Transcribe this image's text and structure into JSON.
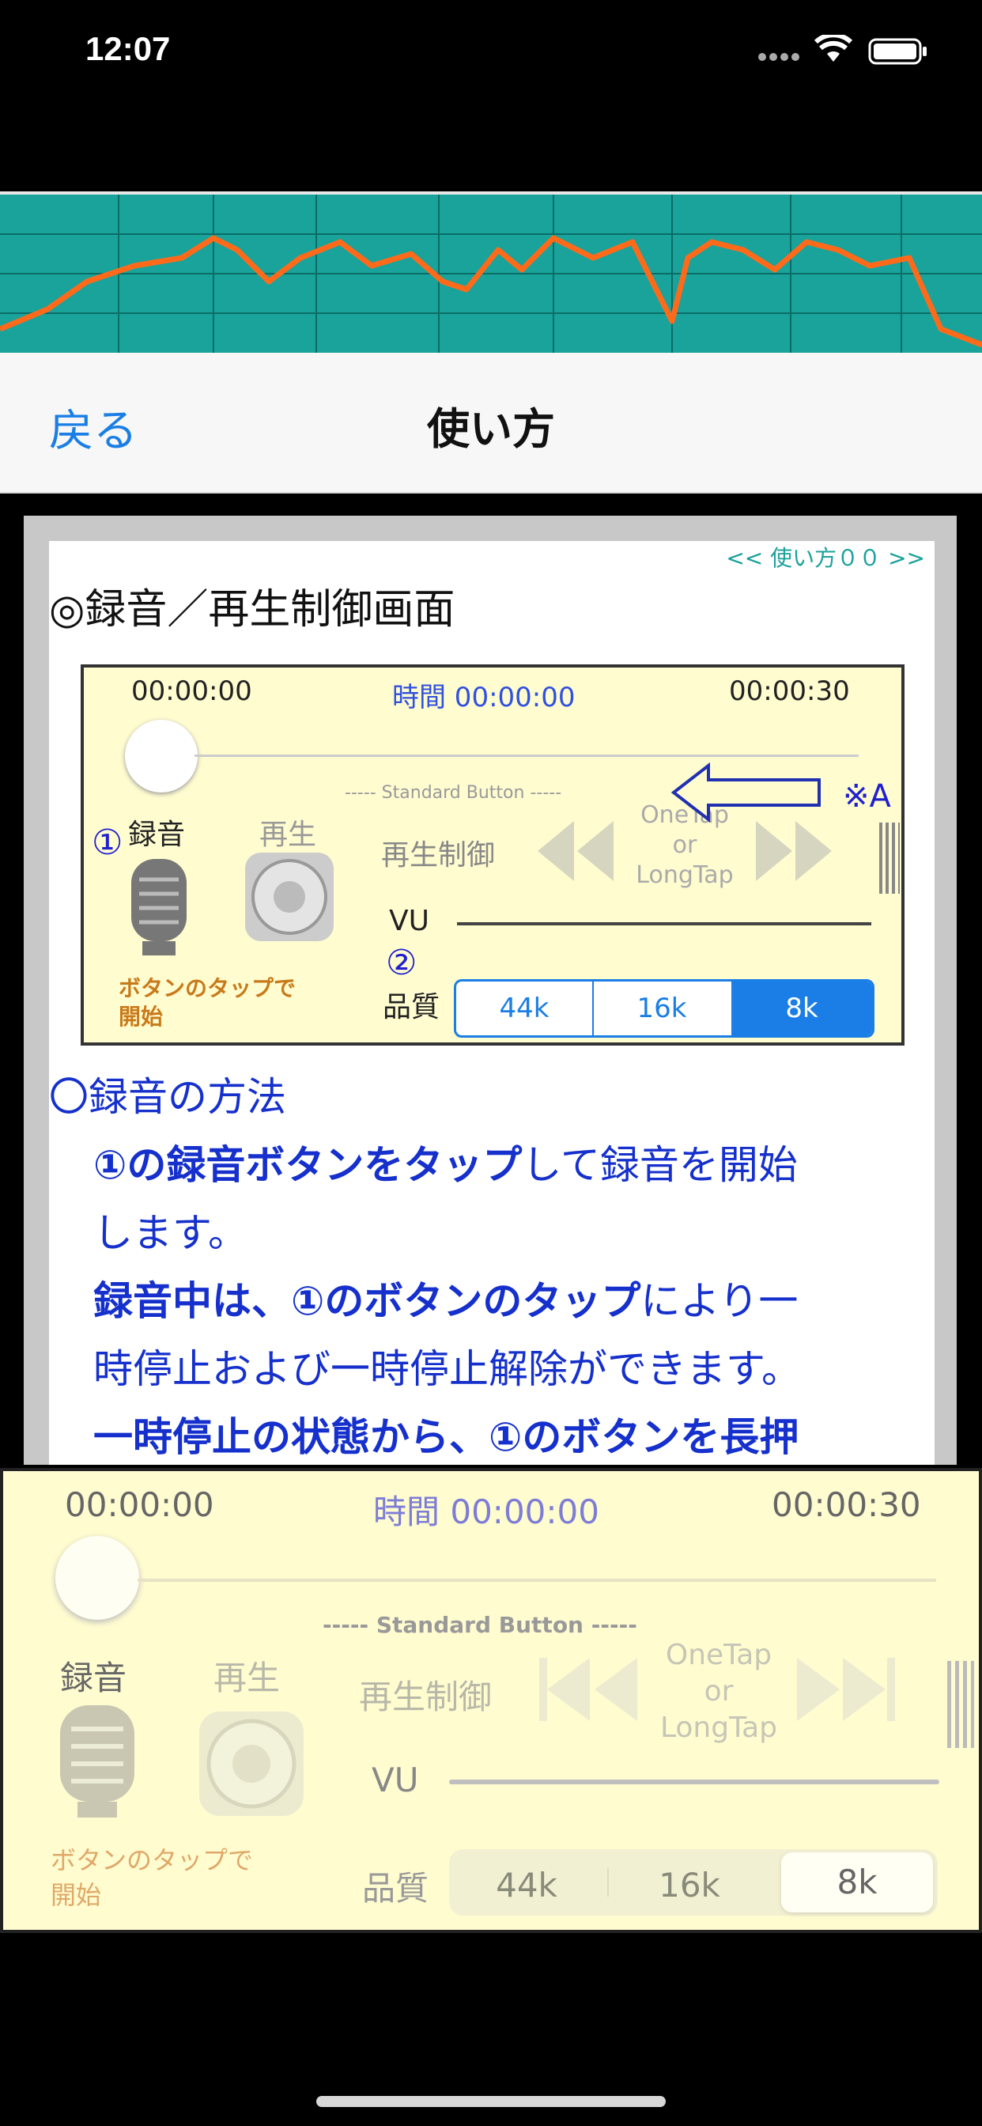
{
  "status_bar": {
    "time": "12:07"
  },
  "nav": {
    "back_label": "戻る",
    "title": "使い方"
  },
  "content": {
    "page_link": "<< 使い方００ >>",
    "section_title": "◎録音／再生制御画面",
    "inner": {
      "time_start": "00:00:00",
      "time_center": "時間 00:00:00",
      "time_end": "00:00:30",
      "standard_button": "----- Standard Button -----",
      "record_label": "録音",
      "play_label": "再生",
      "play_control_label": "再生制御",
      "onetap_line1": "OneTap",
      "onetap_line2": "or",
      "onetap_line3": "LongTap",
      "mark_a": "※A",
      "marker_1": "①",
      "marker_2": "②",
      "vu_label": "VU",
      "tap_hint_line1": "ボタンのタップで",
      "tap_hint_line2": "開始",
      "quality_label": "品質",
      "quality_options": [
        "44k",
        "16k",
        "8k"
      ],
      "quality_selected": "8k"
    },
    "heading_record": "〇録音の方法",
    "p1_bold": "①の録音ボタンをタップ",
    "p1_rest": "して録音を開始",
    "p1_line2": "します。",
    "p2_bold": "録音中は、①のボタンのタップ",
    "p2_rest": "により一",
    "p2_line2": "時停止および一時停止解除ができます。",
    "p3_bold": "一時停止の状態から、①のボタンを長押"
  },
  "control_panel": {
    "time_start": "00:00:00",
    "time_center": "時間 00:00:00",
    "time_end": "00:00:30",
    "standard_button": "----- Standard Button -----",
    "record_label": "録音",
    "play_label": "再生",
    "play_control_label": "再生制御",
    "onetap_line1": "OneTap",
    "onetap_line2": "or",
    "onetap_line3": "LongTap",
    "vu_label": "VU",
    "tap_hint_line1": "ボタンのタップで",
    "tap_hint_line2": "開始",
    "quality_label": "品質",
    "quality_options": [
      "44k",
      "16k",
      "8k"
    ],
    "quality_selected": "8k"
  },
  "colors": {
    "accent_blue": "#1a7ee6",
    "banner_teal": "#19a39b",
    "wave_orange": "#ff6a1a",
    "panel_yellow": "#fffcd0"
  }
}
